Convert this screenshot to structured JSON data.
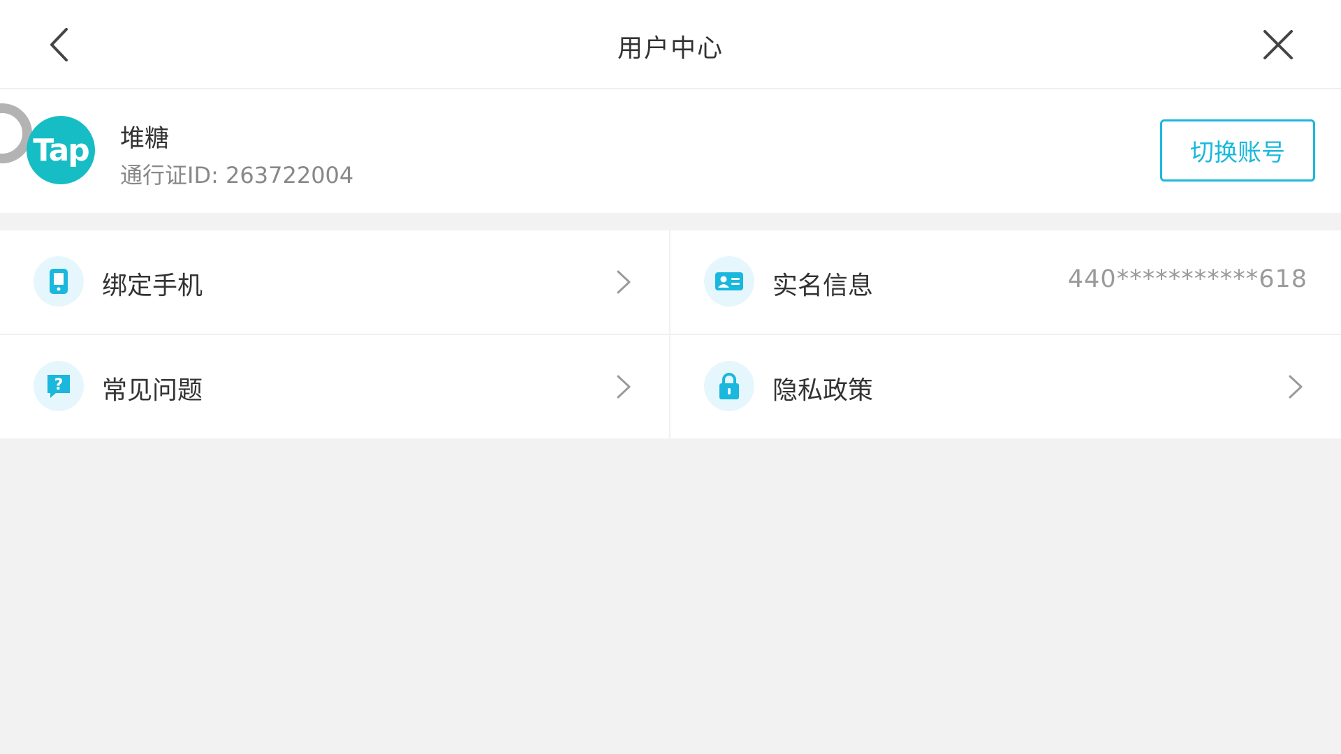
{
  "header": {
    "title": "用户中心"
  },
  "account": {
    "avatar_text": "Tap",
    "username": "堆糖",
    "pass_id": "通行证ID: 263722004",
    "switch_label": "切换账号"
  },
  "menu": {
    "bind_phone": {
      "label": "绑定手机"
    },
    "real_name": {
      "label": "实名信息",
      "value": "440***********618"
    },
    "faq": {
      "label": "常见问题"
    },
    "privacy": {
      "label": "隐私政策"
    }
  },
  "colors": {
    "accent": "#19b8dc",
    "avatar_bg": "#16bdc5",
    "icon_bg": "#e6f6fd"
  },
  "icons": {
    "back": "chevron-left-icon",
    "close": "close-icon",
    "phone": "phone-icon",
    "id_card": "id-card-icon",
    "question": "question-icon",
    "lock": "lock-icon"
  }
}
